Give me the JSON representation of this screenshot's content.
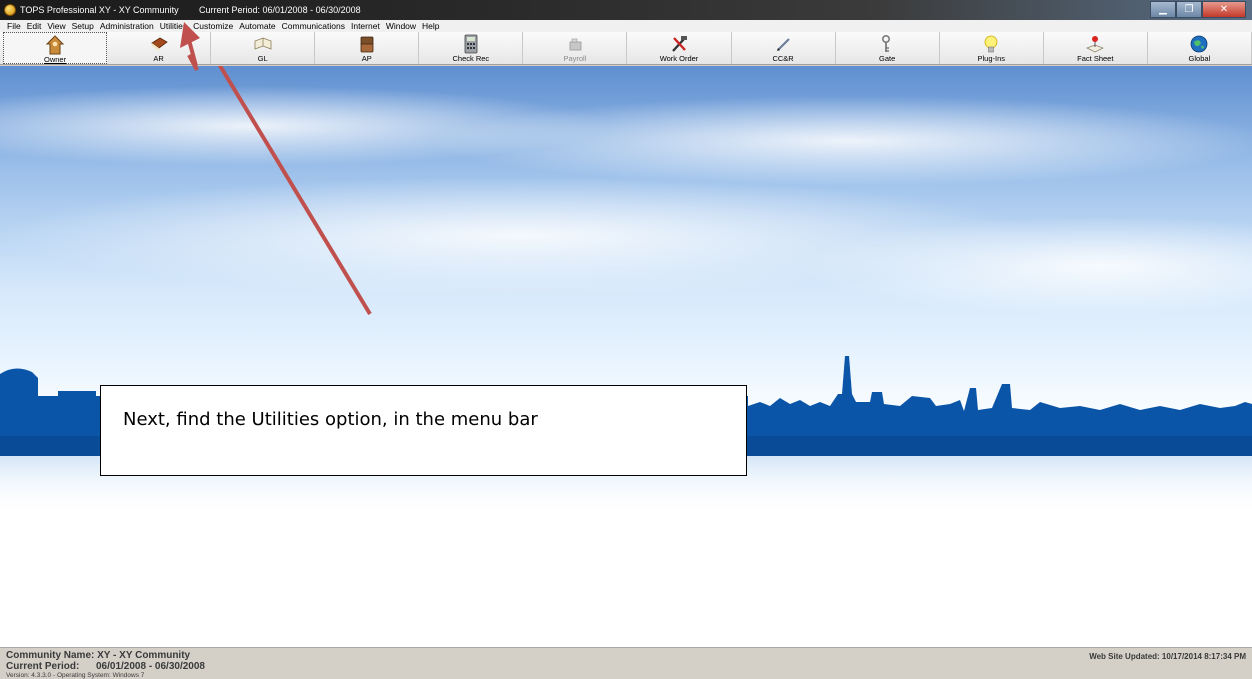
{
  "window": {
    "title": "TOPS Professional  XY - XY Community",
    "period": "Current Period: 06/01/2008 - 06/30/2008"
  },
  "menu": [
    {
      "label": "File"
    },
    {
      "label": "Edit"
    },
    {
      "label": "View"
    },
    {
      "label": "Setup"
    },
    {
      "label": "Administration"
    },
    {
      "label": "Utilities"
    },
    {
      "label": "Customize"
    },
    {
      "label": "Automate"
    },
    {
      "label": "Communications"
    },
    {
      "label": "Internet"
    },
    {
      "label": "Window"
    },
    {
      "label": "Help"
    }
  ],
  "toolbar": [
    {
      "label": "Owner",
      "icon": "owner-icon",
      "selected": true
    },
    {
      "label": "AR",
      "icon": "ar-book-icon"
    },
    {
      "label": "GL",
      "icon": "gl-open-book-icon"
    },
    {
      "label": "AP",
      "icon": "ap-book-icon"
    },
    {
      "label": "Check Rec",
      "icon": "calculator-icon"
    },
    {
      "label": "Payroll",
      "icon": "payroll-icon",
      "disabled": true
    },
    {
      "label": "Work Order",
      "icon": "tools-icon"
    },
    {
      "label": "CC&R",
      "icon": "pen-icon"
    },
    {
      "label": "Gate",
      "icon": "keys-icon"
    },
    {
      "label": "Plug-Ins",
      "icon": "light-bulb-icon"
    },
    {
      "label": "Fact Sheet",
      "icon": "pushpin-icon"
    },
    {
      "label": "Global",
      "icon": "globe-icon"
    }
  ],
  "callout": {
    "text": "Next, find the Utilities option, in the menu bar"
  },
  "status": {
    "community": "Community Name: XY - XY Community",
    "period_label": "Current Period:",
    "period_value": "06/01/2008 - 06/30/2008",
    "version": "Version: 4.3.3.0  -  Operating System: Windows 7",
    "web_updated": "Web Site Updated: 10/17/2014 8:17:34 PM"
  },
  "colors": {
    "sky_top": "#5f8fd0",
    "skyline": "#0b55a8",
    "arrow": "#c0504d"
  }
}
